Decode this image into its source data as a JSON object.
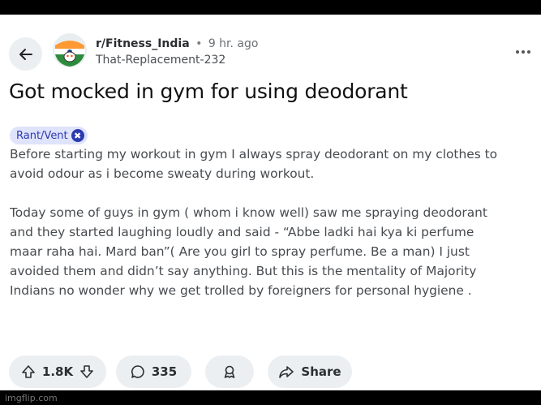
{
  "post": {
    "subreddit": "r/Fitness_India",
    "separator": "•",
    "time": "9 hr. ago",
    "username": "That-Replacement-232",
    "title": "Got mocked in gym for using deodorant",
    "flair": "Rant/Vent",
    "paragraphs": [
      [
        "Before starting my workout in gym I always spray deodorant on my clothes to",
        "avoid odour as i become sweaty during workout."
      ],
      [
        "Today some of guys in gym ( whom i know well) saw me spraying deodorant",
        "and they started laughing loudly and said - “Abbe ladki hai kya ki perfume",
        "maar raha hai. Mard ban”( Are you girl to spray perfume. Be a man) I just",
        "avoided them and didn’t say anything. But this is the mentality of Majority",
        "Indians no wonder why we get trolled by foreigners for personal hygiene ."
      ]
    ]
  },
  "actions": {
    "votes": "1.8K",
    "comments": "335",
    "share_label": "Share"
  },
  "watermark": "imgflip.com",
  "colors": {
    "background": "#ffffff",
    "flair_bg": "#dfe3fb",
    "flair_text": "#2d3bb0",
    "pill_bg": "#eceff1"
  },
  "icons": [
    "back-arrow-icon",
    "subreddit-avatar-icon",
    "more-options-icon",
    "flair-icon",
    "upvote-icon",
    "downvote-icon",
    "comment-icon",
    "award-icon",
    "share-icon"
  ]
}
